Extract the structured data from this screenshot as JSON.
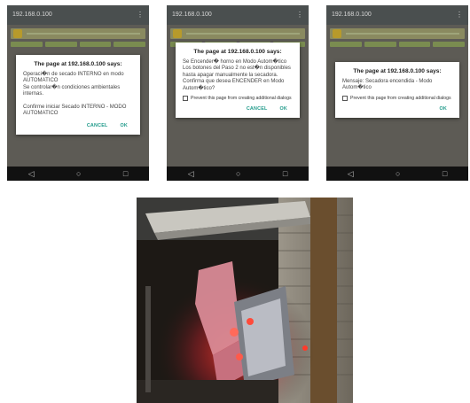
{
  "phones": [
    {
      "status_title": "192.168.0.100",
      "dialog": {
        "title": "The page at 192.168.0.100 says:",
        "message": "Operaci�n de secado INTERNO en modo AUTOMATICO\nSe controlar�n condiciones ambientales internas.\n\nConfirme iniciar Secado INTERNO - MODO AUTOMATICO",
        "buttons": [
          "CANCEL",
          "OK"
        ]
      }
    },
    {
      "status_title": "192.168.0.100",
      "dialog": {
        "title": "The page at 192.168.0.100 says:",
        "message": "Se Encender� horno en Modo Autom�tico\nLos botones del Paso 2 no est�n disponibles hasta apagar manualmente la secadora.\nConfirma que desea ENCENDER en Modo Autom�tico?",
        "checkbox_label": "Prevent this page from creating additional dialogs",
        "buttons": [
          "CANCEL",
          "OK"
        ]
      }
    },
    {
      "status_title": "192.168.0.100",
      "dialog": {
        "title": "The page at 192.168.0.100 says:",
        "message": "Mensaje: Secadora encendida - Modo Autom�tico",
        "checkbox_label": "Prevent this page from creating additional dialogs",
        "buttons": [
          "OK"
        ]
      }
    }
  ],
  "icons": {
    "menu": "more-vert-icon",
    "back": "back-triangle-icon",
    "home": "home-circle-icon",
    "recents": "recents-square-icon"
  },
  "colors": {
    "accent": "#1f9a8a",
    "dialog_bg": "#ffffff",
    "dim": "#5d5b55"
  },
  "photo": {
    "description_icon": "dryer-device-photo"
  }
}
